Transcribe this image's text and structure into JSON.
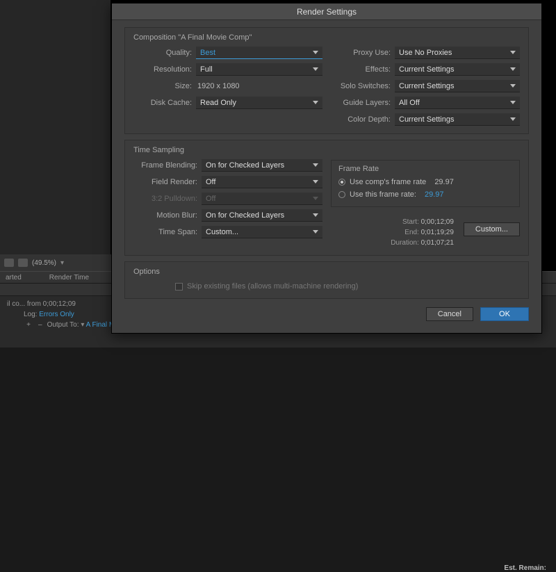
{
  "zoom": {
    "value": "(49.5%)"
  },
  "render_queue": {
    "headers": {
      "status": "arted",
      "rendertime": "Render Time"
    },
    "est_remain": "Est. Remain:",
    "row_text": "il co...  from 0;00;12;09",
    "log_label": "Log:",
    "log_value": "Errors Only",
    "output_label": "Output To:",
    "output_value": "A Final M"
  },
  "dialog": {
    "title": "Render Settings",
    "comp_title": "Composition \"A Final Movie Comp\"",
    "left": {
      "quality_label": "Quality:",
      "quality_value": "Best",
      "resolution_label": "Resolution:",
      "resolution_value": "Full",
      "size_label": "Size:",
      "size_value": "1920 x 1080",
      "diskcache_label": "Disk Cache:",
      "diskcache_value": "Read Only"
    },
    "right": {
      "proxy_label": "Proxy Use:",
      "proxy_value": "Use No Proxies",
      "effects_label": "Effects:",
      "effects_value": "Current Settings",
      "solo_label": "Solo Switches:",
      "solo_value": "Current Settings",
      "guide_label": "Guide Layers:",
      "guide_value": "All Off",
      "depth_label": "Color Depth:",
      "depth_value": "Current Settings"
    },
    "sampling": {
      "title": "Time Sampling",
      "frameblend_label": "Frame Blending:",
      "frameblend_value": "On for Checked Layers",
      "fieldrender_label": "Field Render:",
      "fieldrender_value": "Off",
      "pulldown_label": "3:2 Pulldown:",
      "pulldown_value": "Off",
      "motionblur_label": "Motion Blur:",
      "motionblur_value": "On for Checked Layers",
      "timespan_label": "Time Span:",
      "timespan_value": "Custom..."
    },
    "framerate": {
      "title": "Frame Rate",
      "opt1": "Use comp's frame rate",
      "opt1_value": "29.97",
      "opt2": "Use this frame rate:",
      "opt2_value": "29.97"
    },
    "times": {
      "start_k": "Start:",
      "start_v": "0;00;12;09",
      "end_k": "End:",
      "end_v": "0;01;19;29",
      "dur_k": "Duration:",
      "dur_v": "0;01;07;21",
      "custom_btn": "Custom..."
    },
    "options": {
      "title": "Options",
      "skip": "Skip existing files (allows multi-machine rendering)"
    },
    "buttons": {
      "cancel": "Cancel",
      "ok": "OK"
    }
  }
}
